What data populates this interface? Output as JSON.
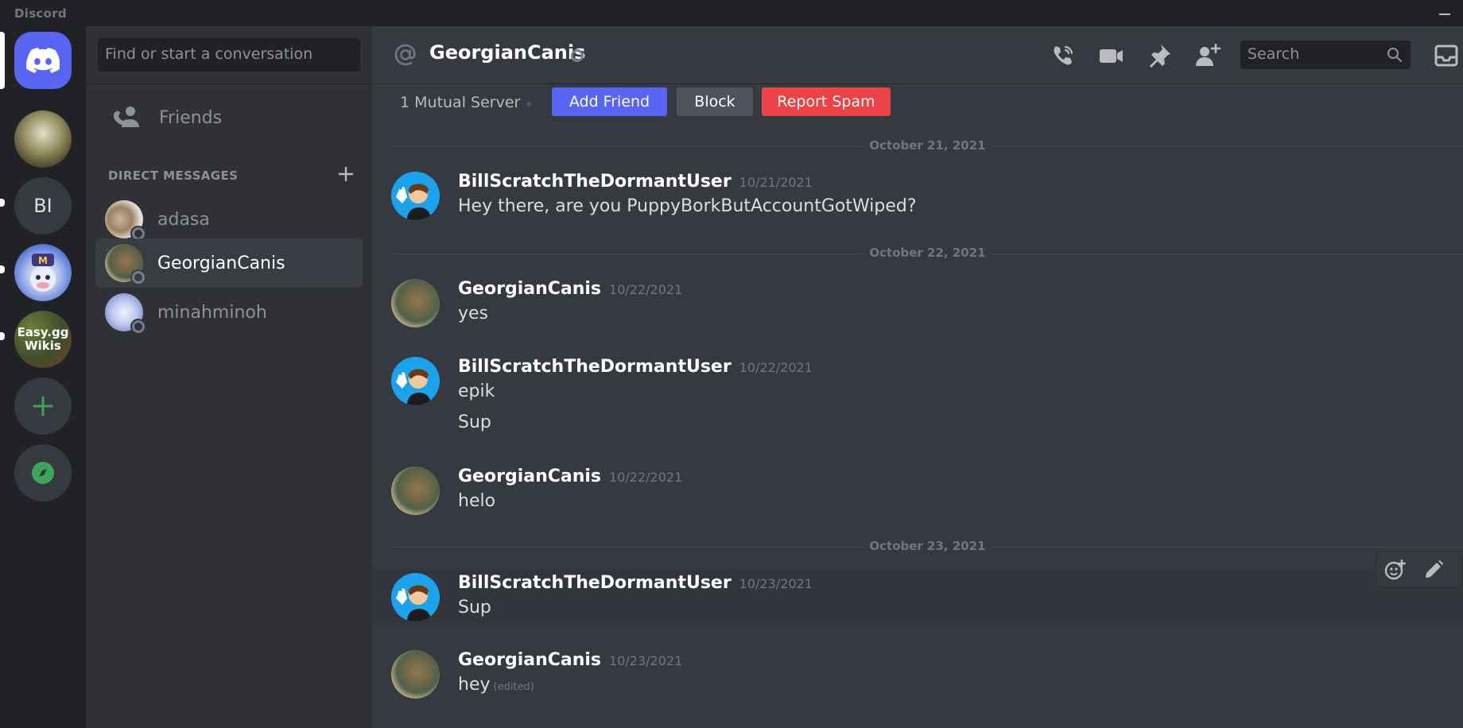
{
  "app": {
    "brand": "Discord"
  },
  "guilds": {
    "bi_label": "BI",
    "easy_label_1": "Easy.gg",
    "easy_label_2": "Wikis"
  },
  "dm_sidebar": {
    "search_placeholder": "Find or start a conversation",
    "friends_label": "Friends",
    "section_label": "DIRECT MESSAGES",
    "items": [
      {
        "name": "adasa",
        "active": false
      },
      {
        "name": "GeorgianCanis",
        "active": true
      },
      {
        "name": "minahminoh",
        "active": false
      }
    ]
  },
  "chat": {
    "title": "GeorgianCanis",
    "search_placeholder": "Search",
    "mutual": "1 Mutual Server",
    "buttons": {
      "add_friend": "Add Friend",
      "block": "Block",
      "report_spam": "Report Spam"
    },
    "dividers": [
      "October 21, 2021",
      "October 22, 2021",
      "October 23, 2021"
    ],
    "messages": [
      {
        "author": "BillScratchTheDormantUser",
        "time": "10/21/2021",
        "lines": [
          "Hey there, are you PuppyBorkButAccountGotWiped?"
        ]
      },
      {
        "author": "GeorgianCanis",
        "time": "10/22/2021",
        "lines": [
          "yes"
        ]
      },
      {
        "author": "BillScratchTheDormantUser",
        "time": "10/22/2021",
        "lines": [
          "epik",
          "Sup"
        ]
      },
      {
        "author": "GeorgianCanis",
        "time": "10/22/2021",
        "lines": [
          "helo"
        ]
      },
      {
        "author": "BillScratchTheDormantUser",
        "time": "10/23/2021",
        "lines": [
          "Sup"
        ]
      },
      {
        "author": "GeorgianCanis",
        "time": "10/23/2021",
        "lines": [
          "hey"
        ],
        "edited": "(edited)"
      }
    ]
  },
  "colors": {
    "blurple": "#5865f2",
    "danger": "#ed4245",
    "online_green": "#3ba55c"
  }
}
